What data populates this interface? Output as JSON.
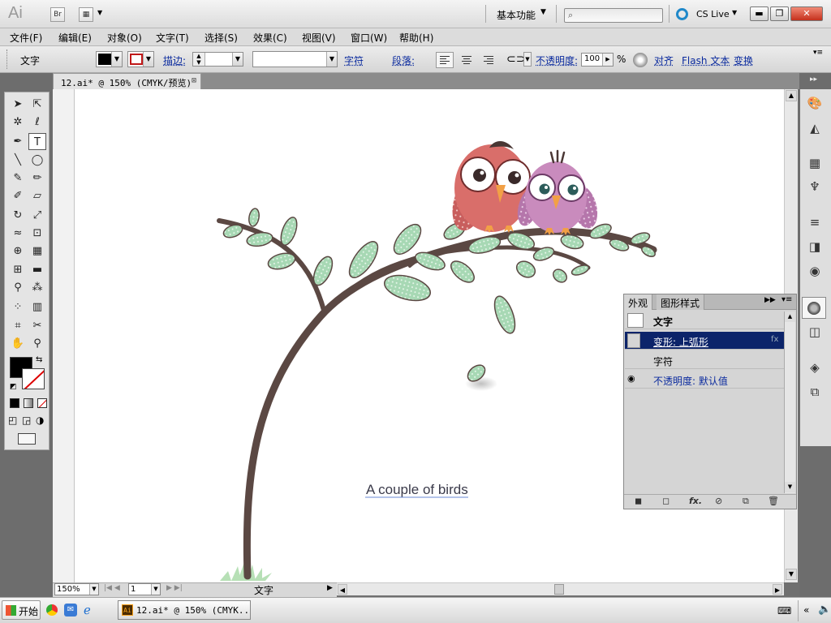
{
  "app": {
    "logo": "Ai",
    "bridge_label": "Br",
    "workspace": "基本功能",
    "cs_live": "CS Live",
    "window_buttons": {
      "minimize": "▬",
      "restore": "❐",
      "close": "✕"
    }
  },
  "menu": [
    "文件(F)",
    "编辑(E)",
    "对象(O)",
    "文字(T)",
    "选择(S)",
    "效果(C)",
    "视图(V)",
    "窗口(W)",
    "帮助(H)"
  ],
  "control_bar": {
    "type_label": "文字",
    "stroke_label": "描边:",
    "char_label": "字符",
    "para_label": "段落:",
    "opacity_label": "不透明度:",
    "opacity_value": "100",
    "opacity_unit": "%",
    "align_label": "对齐",
    "flash_label": "Flash 文本",
    "transform_label": "变换"
  },
  "document": {
    "tab_title": "12.ai* @ 150% (CMYK/预览)",
    "canvas_text": "A couple of birds"
  },
  "status": {
    "zoom": "150%",
    "page": "1",
    "label": "文字"
  },
  "appearance_panel": {
    "tabs": [
      "外观",
      "图形样式"
    ],
    "rows": [
      {
        "label": "文字",
        "bold": true
      },
      {
        "label": "变形: 上弧形",
        "selected": true
      },
      {
        "label": "字符"
      },
      {
        "label": "不透明度: 默认值",
        "eye": true
      }
    ]
  },
  "taskbar": {
    "start_label": "开始",
    "task_title": "12.ai* @ 150% (CMYK..."
  },
  "colors": {
    "leaf": "#a7d8b4",
    "branch": "#5b4843",
    "bird_red": "#d96e6a",
    "bird_purple": "#c98bbd",
    "selection": "#0c246a"
  }
}
